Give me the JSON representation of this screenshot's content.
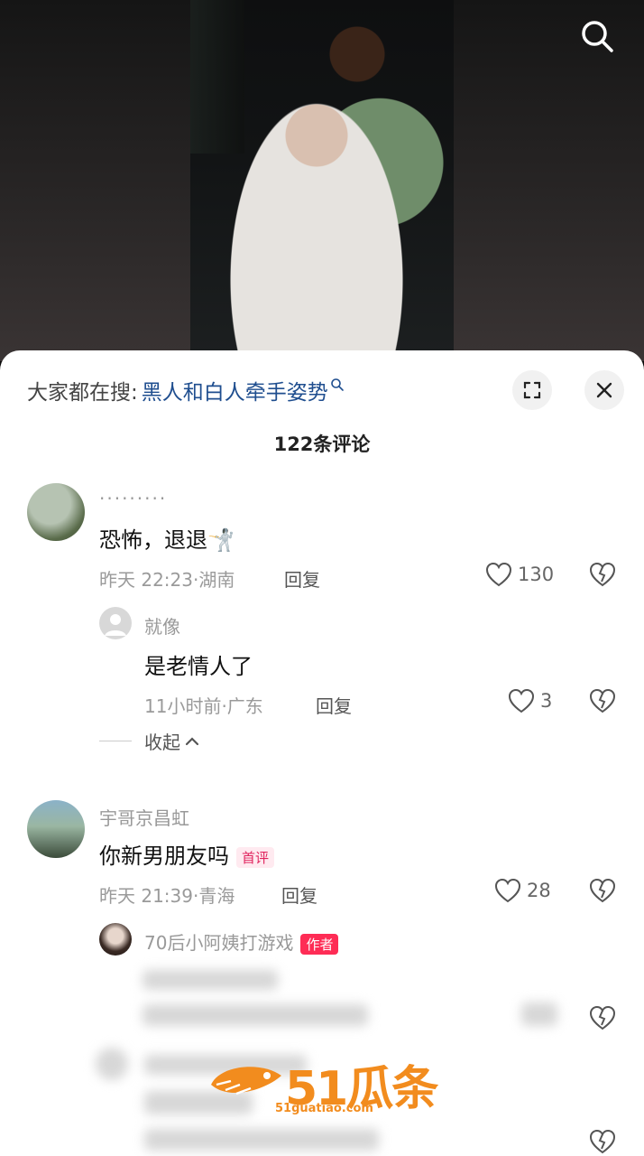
{
  "video": {
    "search_icon": "search-icon"
  },
  "sheet": {
    "search_prefix": "大家都在搜:",
    "search_query": "黑人和白人牵手姿势",
    "comments_count": "122条评论"
  },
  "comments": [
    {
      "username": "·········",
      "text": "恐怖，退退🤺",
      "time": "昨天 22:23·湖南",
      "reply_label": "回复",
      "likes": "130"
    },
    {
      "username": "就像",
      "text": "是老情人了",
      "time": "11小时前·广东",
      "reply_label": "回复",
      "likes": "3"
    },
    {
      "username": "宇哥京昌虹",
      "text": "你新男朋友吗",
      "badge": "首评",
      "time": "昨天 21:39·青海",
      "reply_label": "回复",
      "likes": "28"
    },
    {
      "username": "70后小阿姨打游戏",
      "badge": "作者"
    }
  ],
  "collapse_label": "收起",
  "watermark": {
    "brand": "51瓜条",
    "url": "51guatiao.com"
  },
  "colors": {
    "accent": "#fe2c55",
    "link": "#1f4e8f",
    "watermark": "#f28c1e"
  }
}
